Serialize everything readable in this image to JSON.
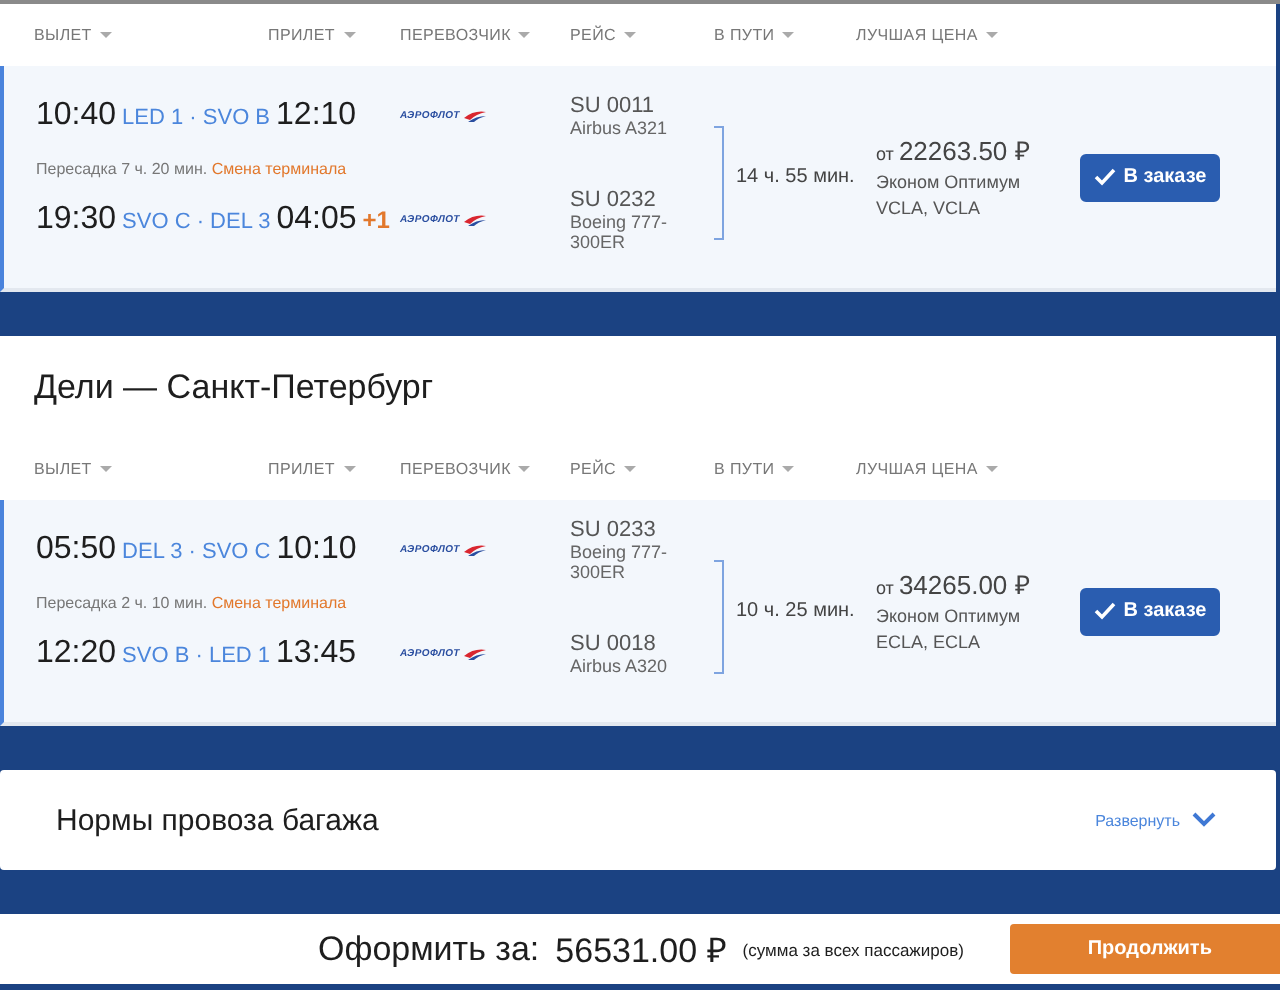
{
  "trips": [
    {
      "columns": [
        "ВЫЛЕТ",
        "ПРИЛЕТ",
        "ПЕРЕВОЗЧИК",
        "РЕЙС",
        "В ПУТИ",
        "ЛУЧШАЯ ЦЕНА"
      ],
      "segments": [
        {
          "departure": "10:40",
          "airports": "LED 1 · SVO B",
          "arrival": "12:10",
          "carrier": "АЭРОФЛОТ",
          "flight": "SU 0011",
          "aircraft": "Airbus A321"
        },
        {
          "departure": "19:30",
          "airports": "SVO C · DEL 3",
          "arrival": "04:05",
          "next_day": "+1",
          "carrier": "АЭРОФЛОТ",
          "flight": "SU 0232",
          "aircraft": "Boeing 777-300ER"
        }
      ],
      "transfer": {
        "text": "Пересадка 7 ч. 20 мин.",
        "warning": "Смена терминала"
      },
      "duration": "14 ч. 55 мин.",
      "price_prefix": "от",
      "price": "22263.50 ₽",
      "fare": "Эконом Оптимум",
      "fare_codes": "VCLA, VCLA",
      "button": "В заказе",
      "selected": true
    },
    {
      "title": "Дели — Санкт-Петербург",
      "columns": [
        "ВЫЛЕТ",
        "ПРИЛЕТ",
        "ПЕРЕВОЗЧИК",
        "РЕЙС",
        "В ПУТИ",
        "ЛУЧШАЯ ЦЕНА"
      ],
      "segments": [
        {
          "departure": "05:50",
          "airports": "DEL 3 · SVO C",
          "arrival": "10:10",
          "carrier": "АЭРОФЛОТ",
          "flight": "SU 0233",
          "aircraft": "Boeing 777-300ER"
        },
        {
          "departure": "12:20",
          "airports": "SVO B · LED 1",
          "arrival": "13:45",
          "carrier": "АЭРОФЛОТ",
          "flight": "SU 0018",
          "aircraft": "Airbus A320"
        }
      ],
      "transfer": {
        "text": "Пересадка 2 ч. 10 мин.",
        "warning": "Смена терминала"
      },
      "duration": "10 ч. 25 мин.",
      "price_prefix": "от",
      "price": "34265.00 ₽",
      "fare": "Эконом Оптимум",
      "fare_codes": "ECLA, ECLA",
      "button": "В заказе",
      "selected": true
    }
  ],
  "baggage": {
    "title": "Нормы провоза багажа",
    "toggle": "Развернуть",
    "expanded": false
  },
  "footer": {
    "label": "Оформить за:",
    "total": "56531.00 ₽",
    "note": "(сумма за всех пассажиров)",
    "button": "Продолжить"
  }
}
